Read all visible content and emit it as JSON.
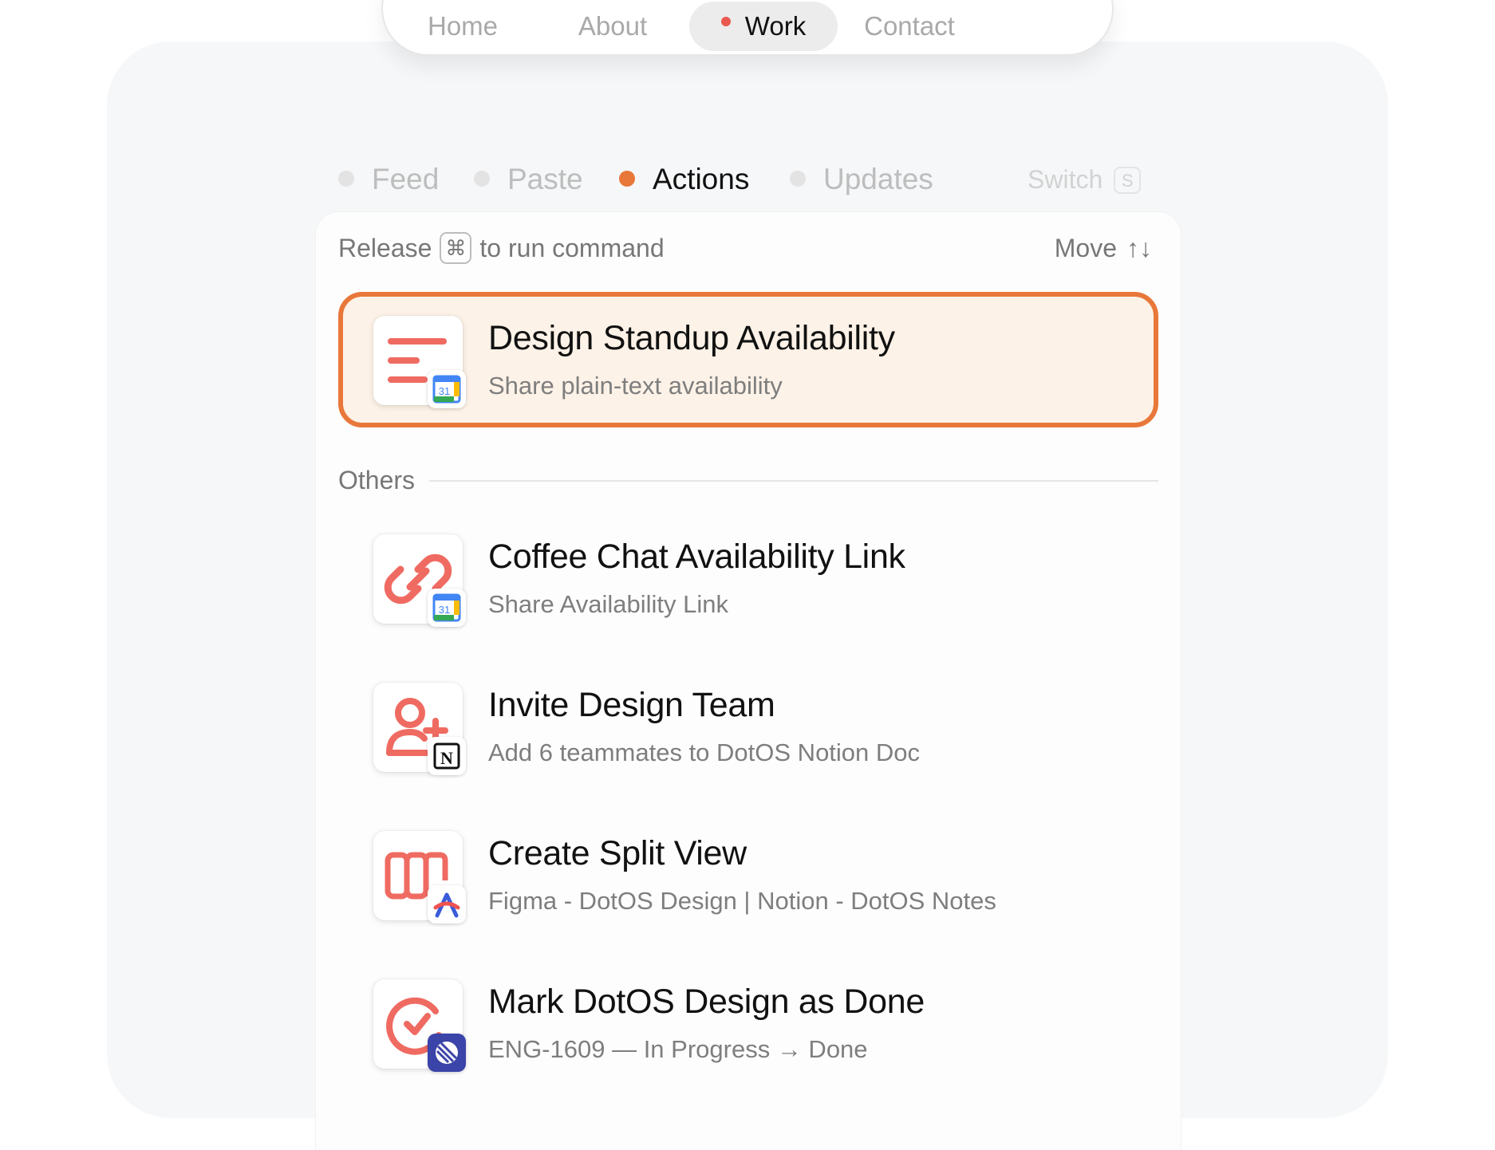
{
  "nav": {
    "items": [
      {
        "label": "Home",
        "active": false
      },
      {
        "label": "About",
        "active": false
      },
      {
        "label": "Work",
        "active": true
      },
      {
        "label": "Contact",
        "active": false
      }
    ]
  },
  "tabs": {
    "items": [
      {
        "label": "Feed",
        "active": false
      },
      {
        "label": "Paste",
        "active": false
      },
      {
        "label": "Actions",
        "active": true
      },
      {
        "label": "Updates",
        "active": false
      }
    ],
    "switch_label": "Switch",
    "switch_key": "S"
  },
  "panel": {
    "hint_release": "Release",
    "hint_key": "⌘",
    "hint_run": "to run command",
    "hint_move": "Move",
    "hint_arrows": "↑↓",
    "selected": {
      "title": "Design Standup Availability",
      "subtitle": "Share plain-text availability",
      "icon": "text-lines-icon",
      "badge": "google-calendar-icon"
    },
    "others_label": "Others",
    "others": [
      {
        "title": "Coffee Chat Availability Link",
        "subtitle": "Share Availability Link",
        "icon": "link-icon",
        "badge": "google-calendar-icon"
      },
      {
        "title": "Invite Design Team",
        "subtitle": "Add 6 teammates to DotOS Notion Doc",
        "icon": "add-user-icon",
        "badge": "notion-icon"
      },
      {
        "title": "Create Split View",
        "subtitle": "Figma - DotOS Design | Notion - DotOS Notes",
        "icon": "split-view-icon",
        "badge": "arc-icon"
      },
      {
        "title": "Mark DotOS Design as Done",
        "subtitle": "ENG-1609 — In Progress → Done",
        "icon": "check-circle-icon",
        "badge": "linear-icon"
      }
    ]
  },
  "colors": {
    "accent": "#e8783a",
    "icon_red": "#ef6b62",
    "selected_bg": "#fdf2e7",
    "nav_dot": "#e8584f"
  },
  "calendar_badge_text": "31"
}
